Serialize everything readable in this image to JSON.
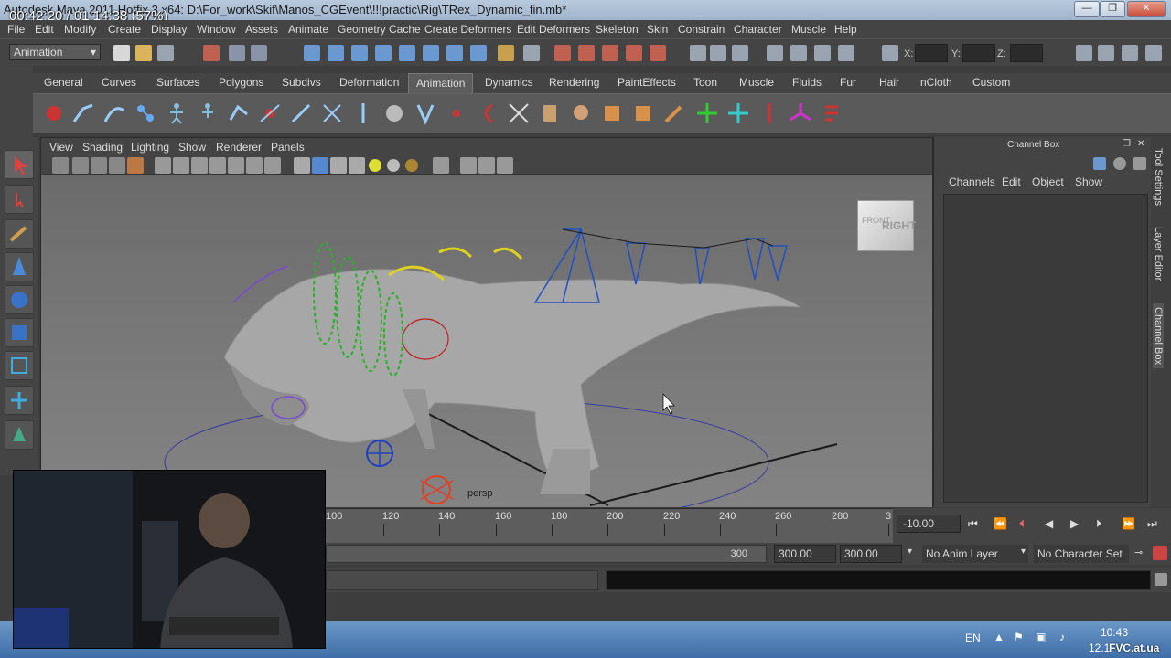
{
  "window": {
    "title": "Autodesk Maya 2011 Hotfix 3 x64: D:\\For_work\\Skif\\Manos_CGEvent\\!!!practic\\Rig\\TRex_Dynamic_fin.mb*",
    "timer_overlay": "00:42:20 / 01:14:38 (57%)",
    "minimize": "—",
    "maximize": "❐",
    "close": "✕"
  },
  "menubar": [
    "File",
    "Edit",
    "Modify",
    "Create",
    "Display",
    "Window",
    "Assets",
    "Animate",
    "Geometry Cache",
    "Create Deformers",
    "Edit Deformers",
    "Skeleton",
    "Skin",
    "Constrain",
    "Character",
    "Muscle",
    "Help"
  ],
  "statusline": {
    "mode": "Animation",
    "x_label": "X:",
    "y_label": "Y:",
    "z_label": "Z:"
  },
  "shelf_tabs": [
    "General",
    "Curves",
    "Surfaces",
    "Polygons",
    "Subdivs",
    "Deformation",
    "Animation",
    "Dynamics",
    "Rendering",
    "PaintEffects",
    "Toon",
    "Muscle",
    "Fluids",
    "Fur",
    "Hair",
    "nCloth",
    "Custom"
  ],
  "shelf_active_tab": "Animation",
  "viewport": {
    "menu": [
      "View",
      "Shading",
      "Lighting",
      "Show",
      "Renderer",
      "Panels"
    ],
    "viewcube_label": "RIGHT",
    "viewcube_front": "FRONT",
    "camera_label": "persp"
  },
  "channel_box": {
    "title": "Channel Box",
    "menu": [
      "Channels",
      "Edit",
      "Object",
      "Show"
    ]
  },
  "side_tabs": [
    "Tool Settings",
    "Layer Editor",
    "Channel Box"
  ],
  "timeline": {
    "ticks": [
      "100",
      "120",
      "140",
      "160",
      "180",
      "200",
      "220",
      "240",
      "260",
      "280",
      "3"
    ],
    "current_frame": "-10.00"
  },
  "range": {
    "end_field": "300",
    "anim_end": "300.00",
    "range_end": "300.00",
    "anim_layer": "No Anim Layer",
    "character_set": "No Character Set"
  },
  "taskbar": {
    "language": "EN",
    "time": "10:43",
    "date": "12.1",
    "watermark": "FVC.at.ua"
  },
  "colors": {
    "maya_panel": "#444444",
    "viewport_bg": "#6b6b6b",
    "shelf_active": "#5c5c5c",
    "titlebar": "#b9c9dc"
  }
}
